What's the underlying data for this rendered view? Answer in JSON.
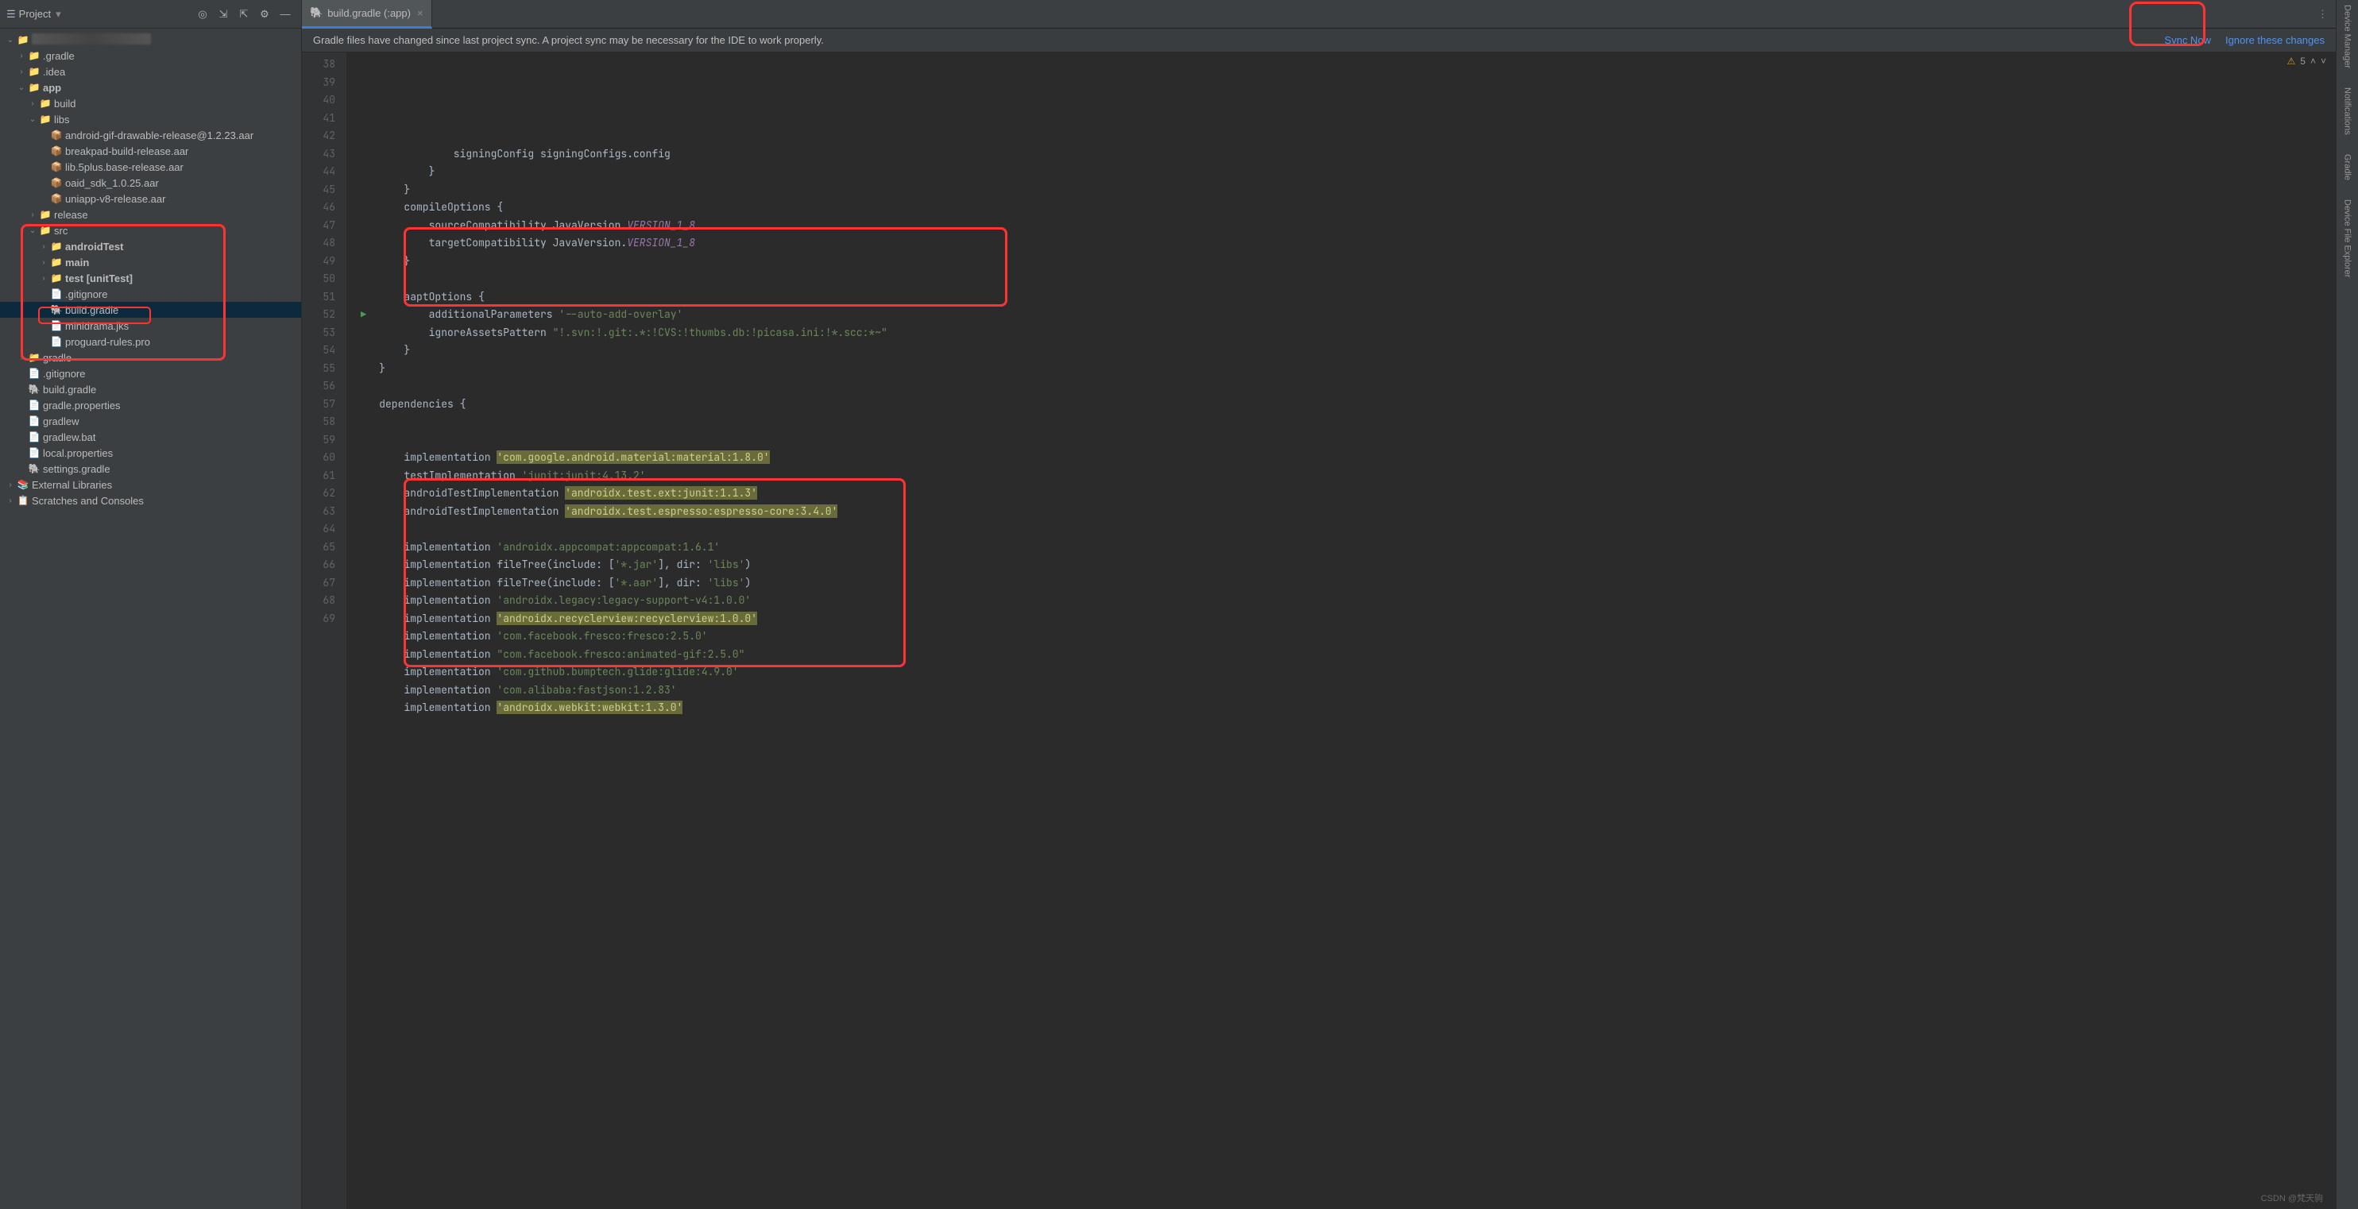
{
  "header": {
    "project_label": "Project",
    "tab_title": "build.gradle (:app)",
    "sync_msg": "Gradle files have changed since last project sync. A project sync may be necessary for the IDE to work properly.",
    "sync_now": "Sync Now",
    "ignore": "Ignore these changes",
    "warn_count": "5"
  },
  "right_tools": [
    "Device Manager",
    "Notifications",
    "Gradle",
    "Device File Explorer"
  ],
  "tree": [
    {
      "ind": 0,
      "arr": "v",
      "ic": "📁",
      "cls": "folder-c",
      "txt": "",
      "bold": false,
      "blur": true
    },
    {
      "ind": 1,
      "arr": ">",
      "ic": "📁",
      "cls": "folder-c",
      "txt": ".gradle"
    },
    {
      "ind": 1,
      "arr": ">",
      "ic": "📁",
      "cls": "folder-c",
      "txt": ".idea"
    },
    {
      "ind": 1,
      "arr": "v",
      "ic": "📁",
      "cls": "folder-c",
      "txt": "app",
      "bold": true
    },
    {
      "ind": 2,
      "arr": ">",
      "ic": "📁",
      "cls": "folder-o",
      "txt": "build"
    },
    {
      "ind": 2,
      "arr": "v",
      "ic": "📁",
      "cls": "folder-c",
      "txt": "libs"
    },
    {
      "ind": 3,
      "arr": "",
      "ic": "📦",
      "cls": "file-c",
      "txt": "android-gif-drawable-release@1.2.23.aar"
    },
    {
      "ind": 3,
      "arr": "",
      "ic": "📦",
      "cls": "file-c",
      "txt": "breakpad-build-release.aar"
    },
    {
      "ind": 3,
      "arr": "",
      "ic": "📦",
      "cls": "file-c",
      "txt": "lib.5plus.base-release.aar"
    },
    {
      "ind": 3,
      "arr": "",
      "ic": "📦",
      "cls": "file-c",
      "txt": "oaid_sdk_1.0.25.aar"
    },
    {
      "ind": 3,
      "arr": "",
      "ic": "📦",
      "cls": "file-c",
      "txt": "uniapp-v8-release.aar"
    },
    {
      "ind": 2,
      "arr": ">",
      "ic": "📁",
      "cls": "folder-c",
      "txt": "release"
    },
    {
      "ind": 2,
      "arr": "v",
      "ic": "📁",
      "cls": "folder-c",
      "txt": "src"
    },
    {
      "ind": 3,
      "arr": ">",
      "ic": "📁",
      "cls": "folder-c",
      "txt": "androidTest",
      "bold": true
    },
    {
      "ind": 3,
      "arr": ">",
      "ic": "📁",
      "cls": "folder-c",
      "txt": "main",
      "bold": true
    },
    {
      "ind": 3,
      "arr": ">",
      "ic": "📁",
      "cls": "folder-c",
      "txt": "test [unitTest]",
      "bold": true
    },
    {
      "ind": 3,
      "arr": "",
      "ic": "📄",
      "cls": "file-c",
      "txt": ".gitignore"
    },
    {
      "ind": 3,
      "arr": "",
      "ic": "🐘",
      "cls": "file-c",
      "txt": "build.gradle",
      "sel": true
    },
    {
      "ind": 3,
      "arr": "",
      "ic": "📄",
      "cls": "file-c",
      "txt": "minidrama.jks"
    },
    {
      "ind": 3,
      "arr": "",
      "ic": "📄",
      "cls": "file-c",
      "txt": "proguard-rules.pro"
    },
    {
      "ind": 1,
      "arr": ">",
      "ic": "📁",
      "cls": "folder-c",
      "txt": "gradle"
    },
    {
      "ind": 1,
      "arr": "",
      "ic": "📄",
      "cls": "file-c",
      "txt": ".gitignore"
    },
    {
      "ind": 1,
      "arr": "",
      "ic": "🐘",
      "cls": "file-c",
      "txt": "build.gradle"
    },
    {
      "ind": 1,
      "arr": "",
      "ic": "📄",
      "cls": "file-c",
      "txt": "gradle.properties"
    },
    {
      "ind": 1,
      "arr": "",
      "ic": "📄",
      "cls": "file-c",
      "txt": "gradlew"
    },
    {
      "ind": 1,
      "arr": "",
      "ic": "📄",
      "cls": "file-c",
      "txt": "gradlew.bat"
    },
    {
      "ind": 1,
      "arr": "",
      "ic": "📄",
      "cls": "file-c",
      "txt": "local.properties"
    },
    {
      "ind": 1,
      "arr": "",
      "ic": "🐘",
      "cls": "file-c",
      "txt": "settings.gradle"
    },
    {
      "ind": 0,
      "arr": ">",
      "ic": "📚",
      "cls": "file-c",
      "txt": "External Libraries"
    },
    {
      "ind": 0,
      "arr": ">",
      "ic": "📋",
      "cls": "file-c",
      "txt": "Scratches and Consoles"
    }
  ],
  "code": {
    "first_line": 38,
    "lines": [
      {
        "seg": [
          {
            "t": "                signingConfig signingConfigs.config"
          }
        ]
      },
      {
        "seg": [
          {
            "t": "            }"
          }
        ]
      },
      {
        "seg": [
          {
            "t": "        }"
          }
        ]
      },
      {
        "seg": [
          {
            "t": "        compileOptions "
          },
          {
            "t": "{",
            "c": "obj"
          }
        ]
      },
      {
        "seg": [
          {
            "t": "            sourceCompatibility JavaVersion."
          },
          {
            "t": "VERSION_1_8",
            "c": "ital"
          }
        ]
      },
      {
        "seg": [
          {
            "t": "            targetCompatibility JavaVersion."
          },
          {
            "t": "VERSION_1_8",
            "c": "ital"
          }
        ]
      },
      {
        "seg": [
          {
            "t": "        }"
          }
        ]
      },
      {
        "seg": [
          {
            "t": ""
          }
        ]
      },
      {
        "seg": [
          {
            "t": "        aaptOptions "
          },
          {
            "t": "{",
            "c": "obj"
          }
        ]
      },
      {
        "seg": [
          {
            "t": "            additionalParameters "
          },
          {
            "t": "'--auto-add-overlay'",
            "c": "str"
          }
        ]
      },
      {
        "seg": [
          {
            "t": "            ignoreAssetsPattern "
          },
          {
            "t": "\"!.svn:!.git:.*:!CVS:!thumbs.db:!picasa.ini:!*.scc:*~\"",
            "c": "str"
          }
        ]
      },
      {
        "seg": [
          {
            "t": "        }"
          }
        ]
      },
      {
        "seg": [
          {
            "t": "    }"
          }
        ]
      },
      {
        "seg": [
          {
            "t": ""
          }
        ]
      },
      {
        "seg": [
          {
            "t": "    dependencies "
          },
          {
            "t": "{",
            "c": "obj"
          }
        ]
      },
      {
        "seg": [
          {
            "t": ""
          }
        ]
      },
      {
        "seg": [
          {
            "t": ""
          }
        ]
      },
      {
        "seg": [
          {
            "t": "        implementation "
          },
          {
            "t": "'com.google.android.material:material:1.8.0'",
            "c": "hl-str"
          }
        ]
      },
      {
        "seg": [
          {
            "t": "        testImplementation "
          },
          {
            "t": "'junit:junit:4.13.2'",
            "c": "str"
          }
        ]
      },
      {
        "seg": [
          {
            "t": "        androidTestImplementation "
          },
          {
            "t": "'androidx.test.ext:junit:1.1.3'",
            "c": "hl-str"
          }
        ]
      },
      {
        "seg": [
          {
            "t": "        androidTestImplementation "
          },
          {
            "t": "'androidx.test.espresso:espresso-core:3.4.0'",
            "c": "hl-str"
          }
        ]
      },
      {
        "seg": [
          {
            "t": ""
          }
        ]
      },
      {
        "seg": [
          {
            "t": "        implementation "
          },
          {
            "t": "'androidx.appcompat:appcompat:1.6.1'",
            "c": "str"
          }
        ]
      },
      {
        "seg": [
          {
            "t": "        implementation fileTree("
          },
          {
            "t": "include",
            "c": "obj"
          },
          {
            "t": ": ["
          },
          {
            "t": "'*.jar'",
            "c": "str"
          },
          {
            "t": "], "
          },
          {
            "t": "dir",
            "c": "obj"
          },
          {
            "t": ": "
          },
          {
            "t": "'libs'",
            "c": "str"
          },
          {
            "t": ")"
          }
        ]
      },
      {
        "seg": [
          {
            "t": "        implementation fileTree("
          },
          {
            "t": "include",
            "c": "obj"
          },
          {
            "t": ": ["
          },
          {
            "t": "'*.aar'",
            "c": "str"
          },
          {
            "t": "], "
          },
          {
            "t": "dir",
            "c": "obj"
          },
          {
            "t": ": "
          },
          {
            "t": "'libs'",
            "c": "str"
          },
          {
            "t": ")"
          }
        ]
      },
      {
        "seg": [
          {
            "t": "        implementation "
          },
          {
            "t": "'androidx.legacy:legacy-support-v4:1.0.0'",
            "c": "str"
          }
        ]
      },
      {
        "seg": [
          {
            "t": "        implementation "
          },
          {
            "t": "'androidx.recyclerview:recyclerview:1.0.0'",
            "c": "hl-str"
          }
        ]
      },
      {
        "seg": [
          {
            "t": "        implementation "
          },
          {
            "t": "'com.facebook.fresco:fresco:2.5.0'",
            "c": "str"
          }
        ]
      },
      {
        "seg": [
          {
            "t": "        implementation "
          },
          {
            "t": "\"com.facebook.fresco:animated-gif:2.5.0\"",
            "c": "str"
          }
        ]
      },
      {
        "seg": [
          {
            "t": "        implementation "
          },
          {
            "t": "'com.github.bumptech.glide:glide:4.9.0'",
            "c": "str"
          }
        ]
      },
      {
        "seg": [
          {
            "t": "        implementation "
          },
          {
            "t": "'com.alibaba:fastjson:1.2.83'",
            "c": "str"
          }
        ]
      },
      {
        "seg": [
          {
            "t": "        implementation "
          },
          {
            "t": "'androidx.webkit:webkit:1.3.0'",
            "c": "hl-str"
          }
        ]
      }
    ]
  },
  "watermark": "CSDN @梵天驹"
}
